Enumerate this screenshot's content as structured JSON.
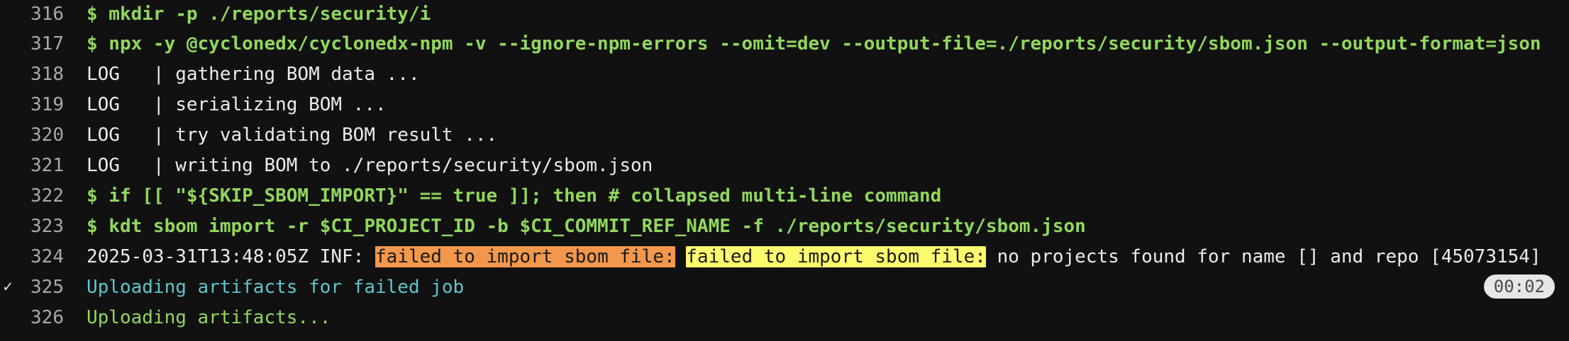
{
  "lines": [
    {
      "num": "316",
      "text": "$ mkdir -p ./reports/security/i"
    },
    {
      "num": "317",
      "text": "$ npx -y @cyclonedx/cyclonedx-npm -v --ignore-npm-errors --omit=dev --output-file=./reports/security/sbom.json --output-format=json"
    },
    {
      "num": "318",
      "text": "LOG   | gathering BOM data ..."
    },
    {
      "num": "319",
      "text": "LOG   | serializing BOM ..."
    },
    {
      "num": "320",
      "text": "LOG   | try validating BOM result ..."
    },
    {
      "num": "321",
      "text": "LOG   | writing BOM to ./reports/security/sbom.json"
    },
    {
      "num": "322",
      "text": "$ if [[ \"${SKIP_SBOM_IMPORT}\" == true ]]; then # collapsed multi-line command"
    },
    {
      "num": "323",
      "text": "$ kdt sbom import -r $CI_PROJECT_ID -b $CI_COMMIT_REF_NAME -f ./reports/security/sbom.json"
    },
    {
      "num": "324",
      "prefix": "2025-03-31T13:48:05Z INF: ",
      "hl1": "failed to import sbom file:",
      "hl2": "failed to import sbom file:",
      "suffix": " no projects found for name [] and repo [45073154]"
    },
    {
      "num": "325",
      "text": "Uploading artifacts for failed job",
      "marker": "✓",
      "duration": "00:02"
    },
    {
      "num": "326",
      "text": "Uploading artifacts..."
    }
  ],
  "colors": {
    "background": "#111111",
    "command": "#91d75d",
    "info": "#5ec6cc",
    "highlight_orange": "#f2974b",
    "highlight_yellow": "#fbfb6d"
  }
}
